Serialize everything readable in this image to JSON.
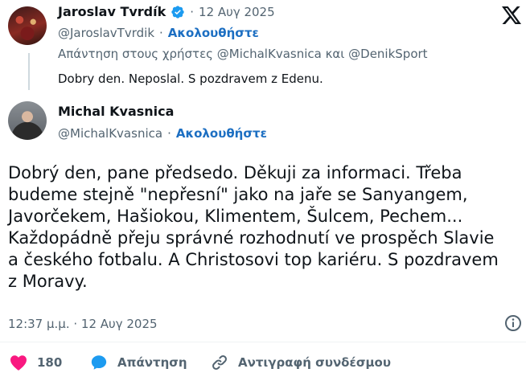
{
  "parent_tweet": {
    "author_name": "Jaroslav Tvrdík",
    "separator": "·",
    "date": "12 Αυγ 2025",
    "handle": "@JaroslavTvrdik",
    "follow_label": "Ακολουθήστε",
    "reply_to": "Απάντηση στους χρήστες @MichalKvasnica και @DenikSport",
    "text": "Dobry den. Neposlal. S pozdravem z Edenu."
  },
  "main_tweet": {
    "author_name": "Michal Kvasnica",
    "handle": "@MichalKvasnica",
    "separator": "·",
    "follow_label": "Ακολουθήστε",
    "text_lines": [
      "Dobrý den, pane předsedo. Děkuji za informaci. Třeba",
      "budeme stejně \"nepřesní\" jako na jaře se Sanyangem,",
      "Javorčekem, Hašiokou, Klimentem, Šulcem, Pechem...",
      "Každopádně přeju správné rozhodnutí ve prospěch Slavie",
      "a českého fotbalu. A Christosovi top kariéru. S pozdravem",
      "z Moravy."
    ],
    "timestamp": "12:37 μ.μ. · 12 Αυγ 2025"
  },
  "actions": {
    "like_count": "180",
    "reply_label": "Απάντηση",
    "copy_link_label": "Αντιγραφή συνδέσμου"
  },
  "colors": {
    "like": "#f91880",
    "reply": "#1d9bf0",
    "verified": "#1d9bf0",
    "muted": "#536471",
    "link": "#1d6fc2"
  },
  "icons": {
    "brand": "x-logo-icon",
    "verified": "verified-badge-icon",
    "info": "info-icon",
    "like": "heart-icon",
    "reply": "reply-bubble-icon",
    "link": "link-icon"
  }
}
